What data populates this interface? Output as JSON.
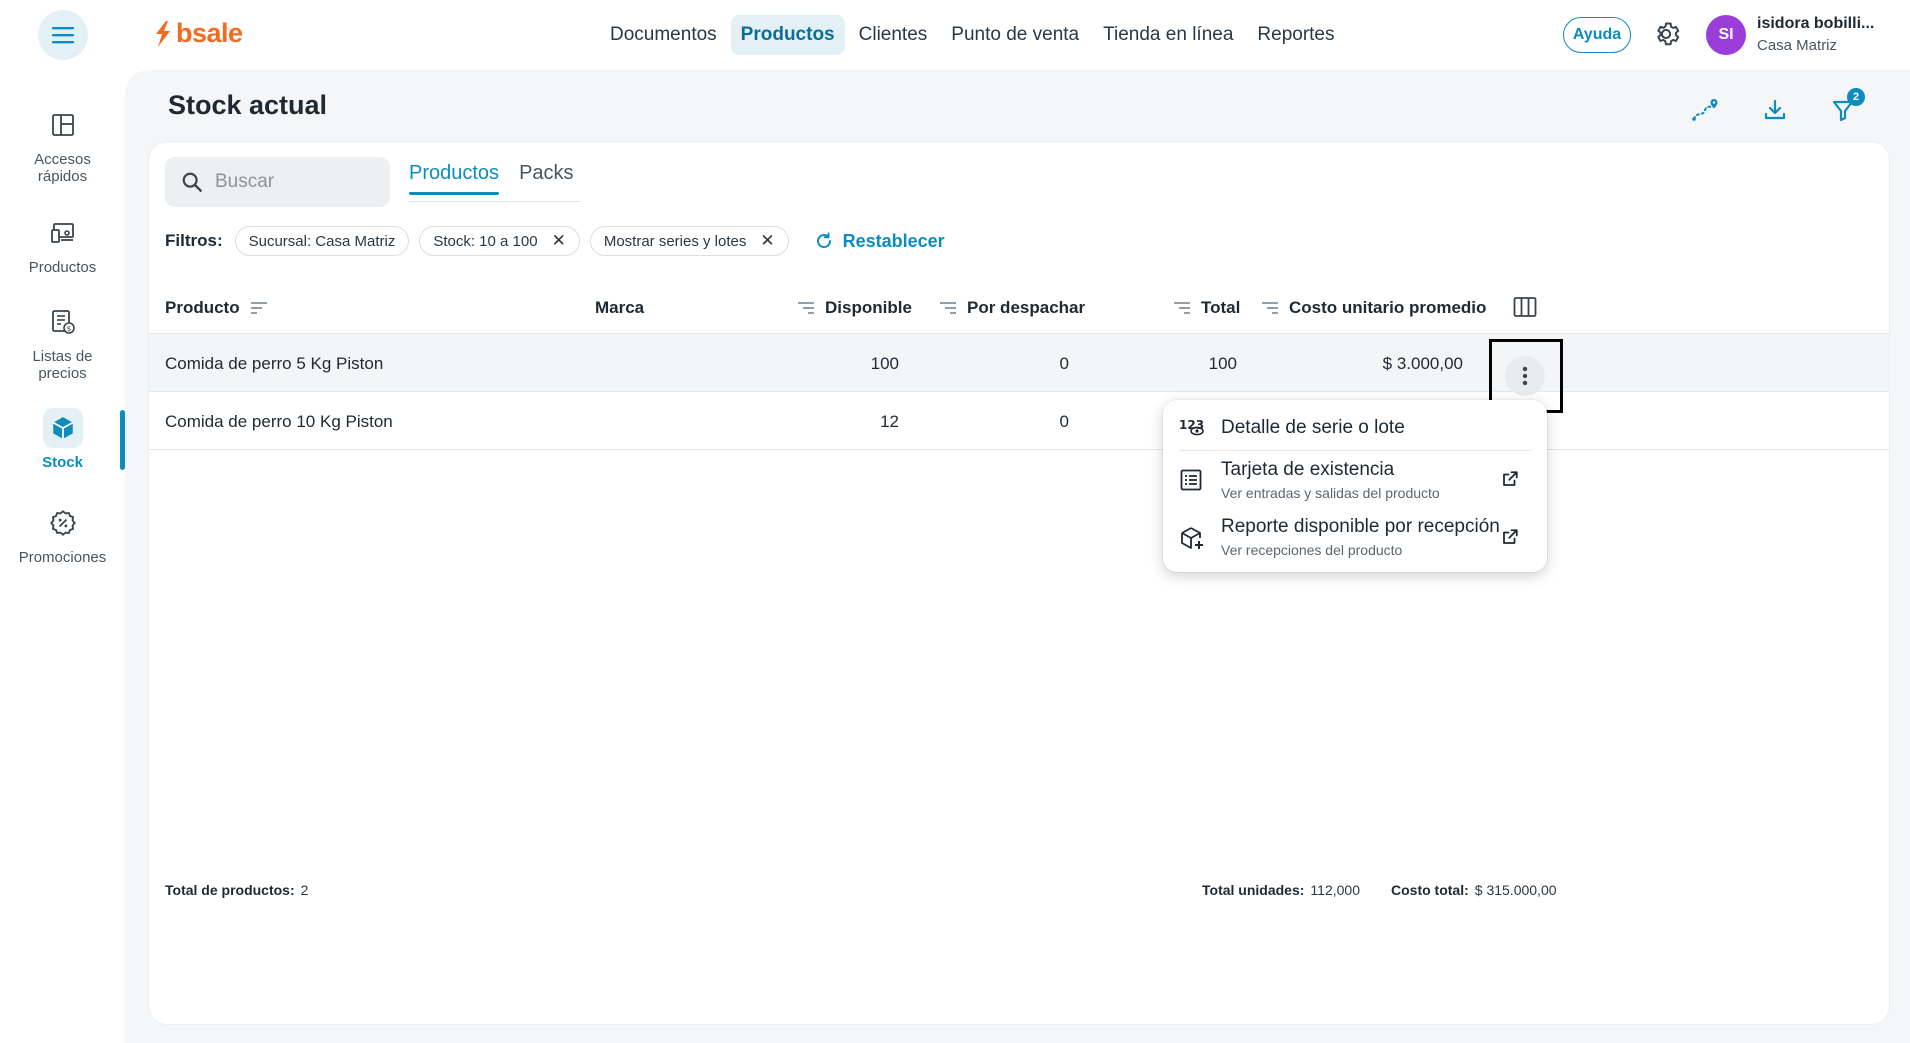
{
  "header": {
    "menu_icon": "hamburger-icon",
    "logo_text": "bsale",
    "nav": [
      {
        "label": "Documentos",
        "active": false
      },
      {
        "label": "Productos",
        "active": true
      },
      {
        "label": "Clientes",
        "active": false
      },
      {
        "label": "Punto de venta",
        "active": false
      },
      {
        "label": "Tienda en línea",
        "active": false
      },
      {
        "label": "Reportes",
        "active": false
      }
    ],
    "help_label": "Ayuda",
    "avatar_initials": "SI",
    "user_name": "isidora bobilli...",
    "user_branch": "Casa Matriz"
  },
  "sidebar": {
    "items": [
      {
        "label": "Accesos rápidos",
        "icon": "quick-access-icon",
        "active": false
      },
      {
        "label": "Productos",
        "icon": "products-icon",
        "active": false
      },
      {
        "label": "Listas de precios",
        "icon": "price-list-icon",
        "active": false
      },
      {
        "label": "Stock",
        "icon": "stock-box-icon",
        "active": true
      },
      {
        "label": "Promociones",
        "icon": "promotions-icon",
        "active": false
      }
    ]
  },
  "page": {
    "title": "Stock actual",
    "filter_badge_count": "2"
  },
  "search": {
    "placeholder": "Buscar",
    "value": ""
  },
  "tabs": [
    {
      "label": "Productos",
      "active": true
    },
    {
      "label": "Packs",
      "active": false
    }
  ],
  "filters": {
    "label": "Filtros:",
    "chips": [
      {
        "label": "Sucursal: Casa Matriz",
        "removable": false
      },
      {
        "label": "Stock: 10 a 100",
        "removable": true
      },
      {
        "label": "Mostrar series y lotes",
        "removable": true
      }
    ],
    "reset_label": "Restablecer"
  },
  "table": {
    "columns": {
      "producto": "Producto",
      "marca": "Marca",
      "disponible": "Disponible",
      "por_despachar": "Por despachar",
      "total": "Total",
      "costo": "Costo unitario promedio"
    },
    "rows": [
      {
        "producto": "Comida de perro 5 Kg Piston",
        "marca": "",
        "disponible": "100",
        "por_despachar": "0",
        "total": "100",
        "costo": "$ 3.000,00"
      },
      {
        "producto": "Comida de perro 10 Kg Piston",
        "marca": "",
        "disponible": "12",
        "por_despachar": "0",
        "total": "",
        "costo": ""
      }
    ]
  },
  "row_menu": {
    "items": [
      {
        "title": "Detalle de serie o lote",
        "subtitle": "",
        "icon": "serial-number-icon",
        "external": false
      },
      {
        "title": "Tarjeta de existencia",
        "subtitle": "Ver entradas y salidas del producto",
        "icon": "list-card-icon",
        "external": true
      },
      {
        "title": "Reporte disponible por recepción",
        "subtitle": "Ver recepciones del producto",
        "icon": "box-add-icon",
        "external": true
      }
    ]
  },
  "footer": {
    "total_products_label": "Total de productos:",
    "total_products_value": "2",
    "total_units_label": "Total unidades:",
    "total_units_value": "112,000",
    "total_cost_label": "Costo total:",
    "total_cost_value": "$ 315.000,00"
  },
  "colors": {
    "accent": "#0d8cbd",
    "brand": "#f26b21",
    "avatar": "#9b3ed9"
  }
}
